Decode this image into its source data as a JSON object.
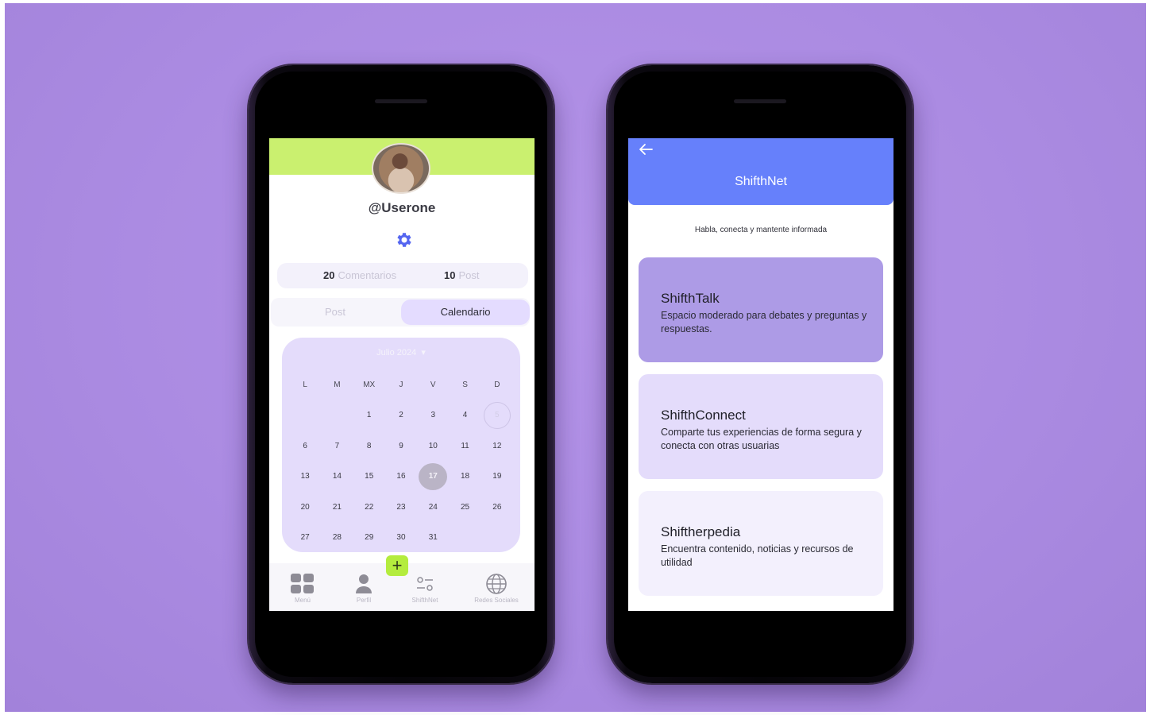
{
  "left_screen": {
    "username": "@Userone",
    "stats": [
      {
        "count": "20",
        "label": "Comentarios"
      },
      {
        "count": "10",
        "label": "Post"
      }
    ],
    "tabs": [
      {
        "label": "Post",
        "active": false
      },
      {
        "label": "Calendario",
        "active": true
      }
    ],
    "calendar": {
      "month": "Julio 2024",
      "weekdays": [
        "L",
        "M",
        "MX",
        "J",
        "V",
        "S",
        "D"
      ],
      "weeks": [
        [
          "",
          "",
          "1",
          "2",
          "3",
          "4",
          "5"
        ],
        [
          "6",
          "7",
          "8",
          "9",
          "10",
          "11",
          "12"
        ],
        [
          "13",
          "14",
          "15",
          "16",
          "17",
          "18",
          "19"
        ],
        [
          "20",
          "21",
          "22",
          "23",
          "24",
          "25",
          "26"
        ],
        [
          "27",
          "28",
          "29",
          "30",
          "31",
          "",
          ""
        ]
      ],
      "today": "17",
      "outlined_day": "5"
    },
    "nav": {
      "menu": "Menú",
      "profile": "Perfil",
      "net": "ShifthNet",
      "social": "Redes Sociales"
    },
    "fab_icon": "plus-icon"
  },
  "right_screen": {
    "title": "ShifthNet",
    "tagline": "Habla, conecta y mantente informada",
    "cards": [
      {
        "title": "ShifthTalk",
        "description": "Espacio moderado para debates y preguntas y respuestas."
      },
      {
        "title": "ShifthConnect",
        "description": "Comparte tus experiencias de forma segura y conecta con otras usuarias"
      },
      {
        "title": "Shiftherpedia",
        "description": "Encuentra contenido, noticias y recursos de utilidad"
      }
    ]
  },
  "colors": {
    "background": "#ab8be2",
    "profile_band": "#caf06f",
    "appbar": "#6680fb",
    "accent_green": "#b4ec3e",
    "calendar_bg": "#e4dcfb",
    "card_1": "#ad9be6",
    "card_2": "#e4dcfb",
    "card_3": "#f3f0fd"
  }
}
